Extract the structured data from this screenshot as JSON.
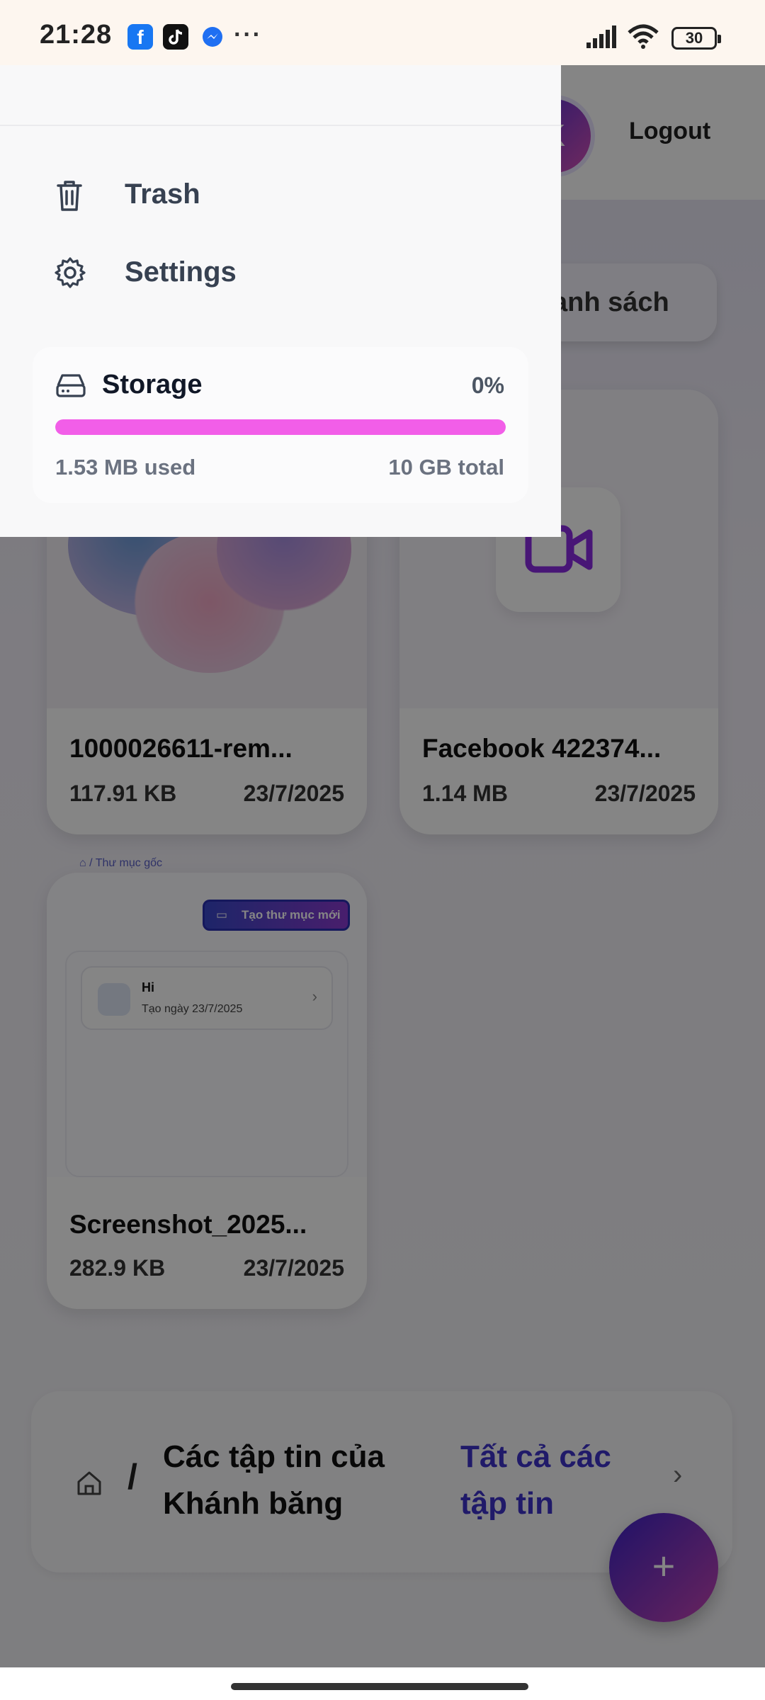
{
  "status_bar": {
    "time": "21:28",
    "notifications": [
      "facebook-icon",
      "tiktok-icon",
      "messenger-icon",
      "more-icon"
    ],
    "battery": "30"
  },
  "header": {
    "avatar_letter": "K",
    "logout_label": "Logout"
  },
  "view_toggle": {
    "label_visible": "anh sách"
  },
  "drawer": {
    "menu": [
      {
        "label": "Trash",
        "icon": "trash-icon"
      },
      {
        "label": "Settings",
        "icon": "gear-icon"
      }
    ],
    "storage": {
      "title": "Storage",
      "percent_label": "0%",
      "used_label": "1.53 MB used",
      "total_label": "10 GB total",
      "bar_fill": 1.0,
      "bar_color": "#f25ee8"
    }
  },
  "files": [
    {
      "name": "1000026611-rem...",
      "size": "117.91 KB",
      "date": "23/7/2025",
      "thumb": "image"
    },
    {
      "name": "Facebook 422374...",
      "size": "1.14 MB",
      "date": "23/7/2025",
      "thumb": "video-icon"
    },
    {
      "name": "Screenshot_2025...",
      "size": "282.9 KB",
      "date": "23/7/2025",
      "thumb": "screenshot"
    }
  ],
  "screenshot_preview": {
    "breadcrumb": "Thư mục gốc",
    "new_folder_button": "Tạo thư mục mới",
    "folder_title": "Hi",
    "folder_subtitle": "Tạo ngày 23/7/2025"
  },
  "breadcrumb": {
    "separator": "/",
    "owner_label": "Các tập tin của Khánh băng",
    "all_files_label": "Tất cả các tập tin"
  },
  "fab": {
    "label": "+"
  },
  "colors": {
    "accent": "#3f32c9",
    "storage_bar": "#f25ee8",
    "video_icon": "#8a2be2"
  }
}
